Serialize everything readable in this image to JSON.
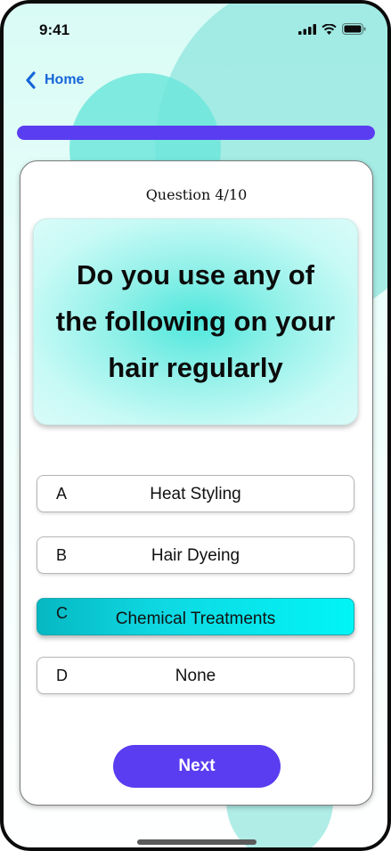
{
  "status_bar": {
    "time": "9:41"
  },
  "nav": {
    "back_label": "Home"
  },
  "progress": {
    "current": 4,
    "total": 10,
    "fraction": 1.0
  },
  "quiz": {
    "counter": "Question 4/10",
    "question": "Do you use any of the following on your hair regularly",
    "options": [
      {
        "letter": "A",
        "label": "Heat Styling",
        "selected": false
      },
      {
        "letter": "B",
        "label": "Hair Dyeing",
        "selected": false
      },
      {
        "letter": "C",
        "label": "Chemical Treatments",
        "selected": true
      },
      {
        "letter": "D",
        "label": "None",
        "selected": false
      }
    ],
    "next_label": "Next"
  },
  "colors": {
    "accent": "#5a3df0",
    "link": "#1565d8",
    "selected_start": "#06b8c2",
    "selected_end": "#00f5f7",
    "background": "#d9fbf5"
  },
  "icons": [
    "signal-icon",
    "wifi-icon",
    "battery-icon",
    "chevron-left-icon"
  ]
}
